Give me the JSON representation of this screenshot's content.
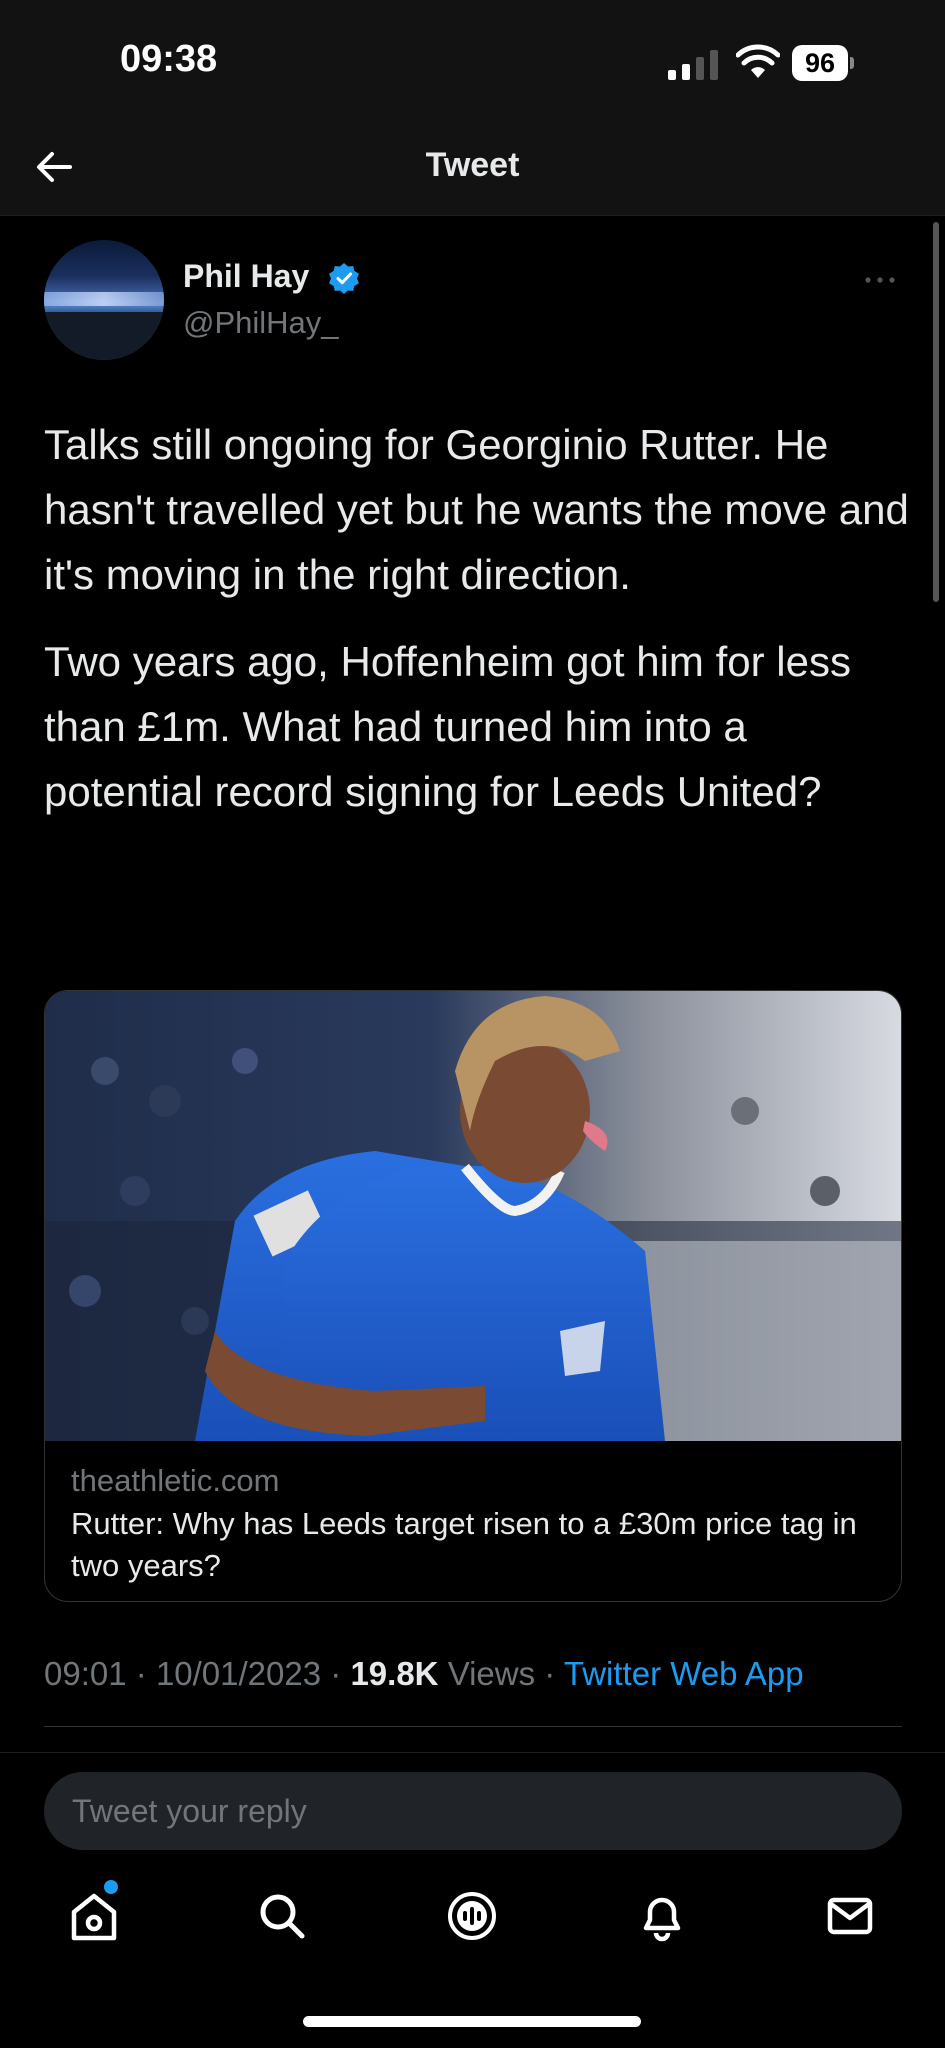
{
  "status_bar": {
    "time": "09:38",
    "battery": "96",
    "icons": [
      "signal-icon",
      "wifi-icon",
      "battery-icon"
    ]
  },
  "nav": {
    "title": "Tweet",
    "back_icon": "back-arrow-icon"
  },
  "tweet": {
    "author_name": "Phil Hay",
    "author_handle": "@PhilHay_",
    "verified": true,
    "paragraphs": [
      "Talks still ongoing for Georginio Rutter. He hasn't travelled yet but he wants the move and it's moving in the right direction.",
      "Two years ago, Hoffenheim got him for less than £1m. What had turned him into a potential record signing for Leeds United?"
    ],
    "card": {
      "domain": "theathletic.com",
      "title": "Rutter: Why has Leeds target risen to a £30m price tag in two years?"
    },
    "meta": {
      "time": "09:01",
      "separator": "·",
      "date": "10/01/2023",
      "views_count": "19.8K",
      "views_label": "Views",
      "source": "Twitter Web App"
    }
  },
  "reply": {
    "placeholder": "Tweet your reply"
  },
  "tab_bar": {
    "items": [
      "home-icon",
      "search-icon",
      "spaces-icon",
      "notifications-icon",
      "messages-icon"
    ]
  },
  "colors": {
    "accent": "#1d9bf0",
    "background": "#000000",
    "text": "#e7e9ea",
    "muted": "#71767b"
  }
}
